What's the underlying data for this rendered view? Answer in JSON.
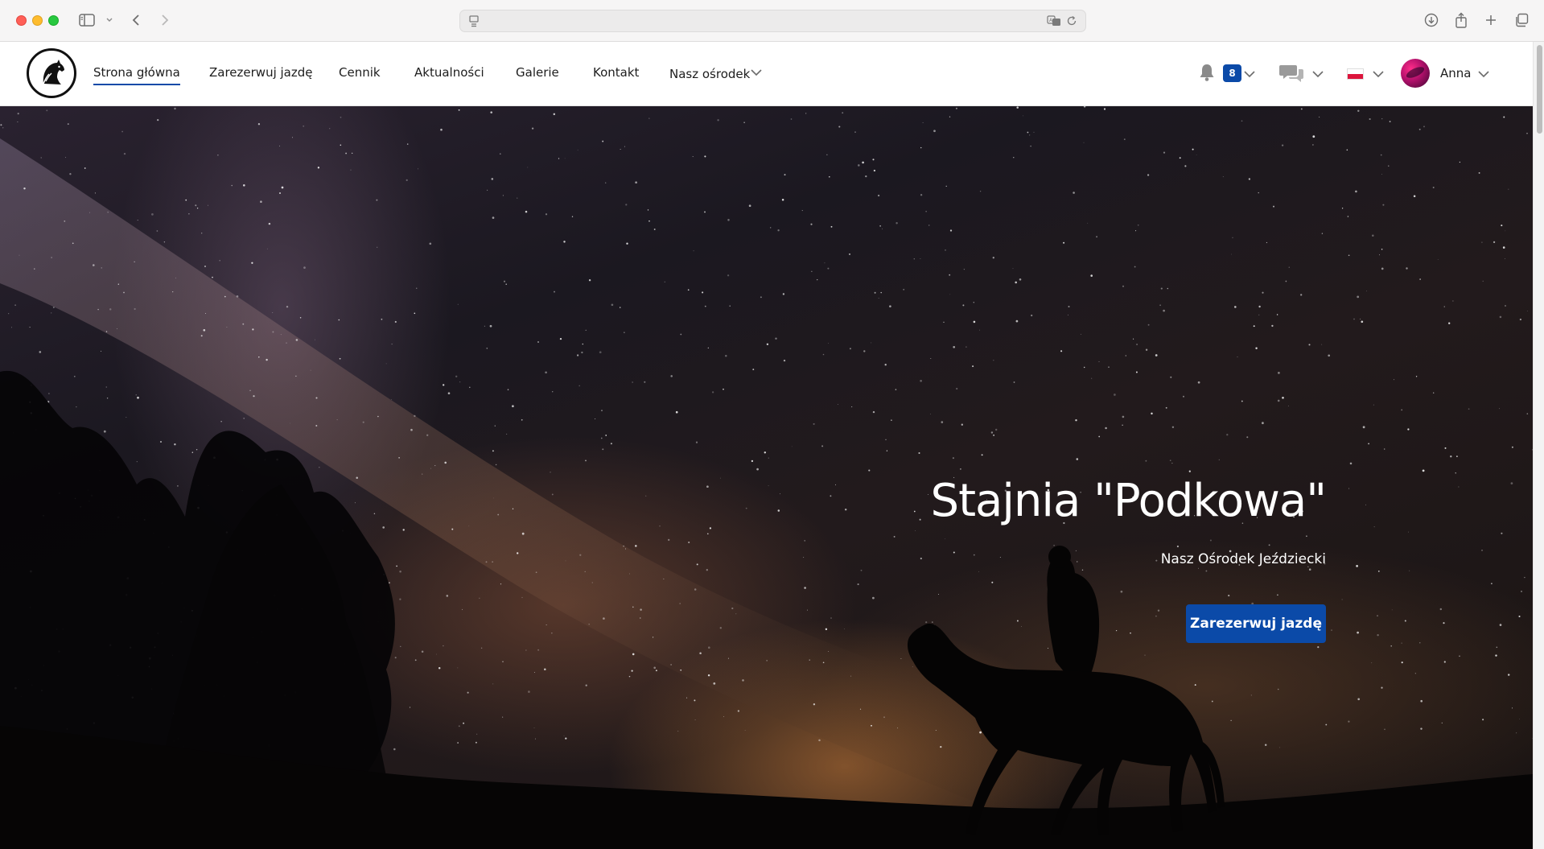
{
  "nav": {
    "items": [
      {
        "label": "Strona główna",
        "active": true
      },
      {
        "label": "Zarezerwuj jazdę",
        "active": false
      },
      {
        "label": "Cennik",
        "active": false
      },
      {
        "label": "Aktualności",
        "active": false
      },
      {
        "label": "Galerie",
        "active": false
      },
      {
        "label": "Kontakt",
        "active": false
      }
    ],
    "dropdown_label": "Nasz ośrodek",
    "notifications_count": "8",
    "user_name": "Anna",
    "language_flag": "pl-flag-icon"
  },
  "hero": {
    "title": "Stajnia \"Podkowa\"",
    "subtitle": "Nasz Ośrodek Jeździecki",
    "cta_label": "Zarezerwuj jazdę"
  },
  "icons": {
    "logo": "horse-head-logo-icon",
    "bell": "bell-icon",
    "chat": "chat-bubbles-icon",
    "chevron": "chevron-down-icon"
  },
  "colors": {
    "accent": "#0b4aa8",
    "nav_text": "#1d1d1d",
    "hero_text": "#ffffff"
  }
}
